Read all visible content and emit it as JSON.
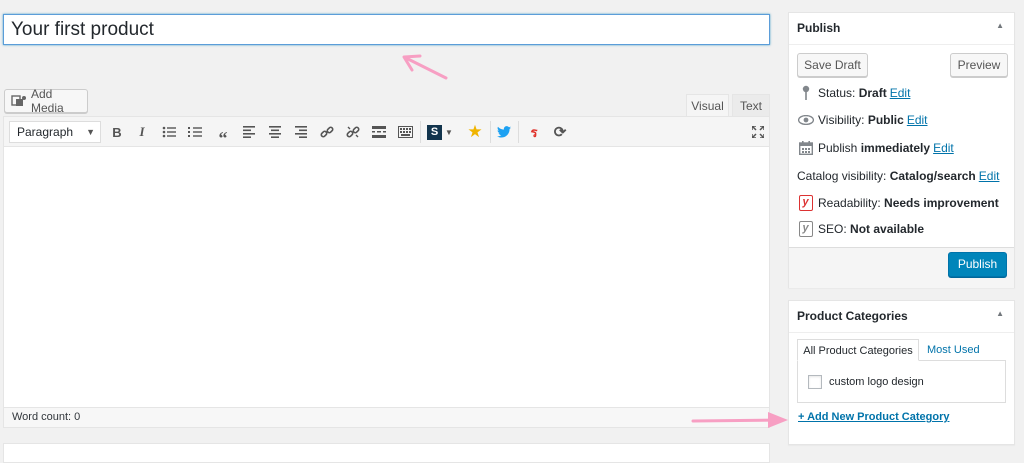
{
  "title": {
    "value": "Your first product"
  },
  "media": {
    "add_media_label": "Add Media"
  },
  "editor": {
    "tabs": [
      "Visual",
      "Text"
    ],
    "format_select": "Paragraph",
    "toolbar_icons": [
      "bold-icon",
      "italic-icon",
      "bullet-list-icon",
      "numbered-list-icon",
      "blockquote-icon",
      "align-left-icon",
      "align-center-icon",
      "align-right-icon",
      "link-icon",
      "unlink-icon",
      "read-more-icon",
      "toolbar-toggle-icon",
      "s-plugin-icon",
      "star-icon",
      "twitter-icon",
      "shortcode-icon",
      "refresh-icon",
      "fullscreen-icon"
    ],
    "word_count": "Word count: 0"
  },
  "publish": {
    "heading": "Publish",
    "save_draft": "Save Draft",
    "preview": "Preview",
    "status_label": "Status:",
    "status_value": "Draft",
    "visibility_label": "Visibility:",
    "visibility_value": "Public",
    "publish_label": "Publish",
    "publish_value": "immediately",
    "catalog_label": "Catalog visibility:",
    "catalog_value": "Catalog/search",
    "readability_label": "Readability:",
    "readability_value": "Needs improvement",
    "seo_label": "SEO:",
    "seo_value": "Not available",
    "edit_link": "Edit",
    "publish_button": "Publish"
  },
  "categories": {
    "heading": "Product Categories",
    "tab_all": "All Product Categories",
    "tab_most_used": "Most Used",
    "items": [
      {
        "label": "custom logo design",
        "checked": false
      }
    ],
    "add_new": "+ Add New Product Category"
  },
  "colors": {
    "accent": "#0085ba",
    "link": "#0073aa",
    "arrow": "#f79fc3"
  }
}
